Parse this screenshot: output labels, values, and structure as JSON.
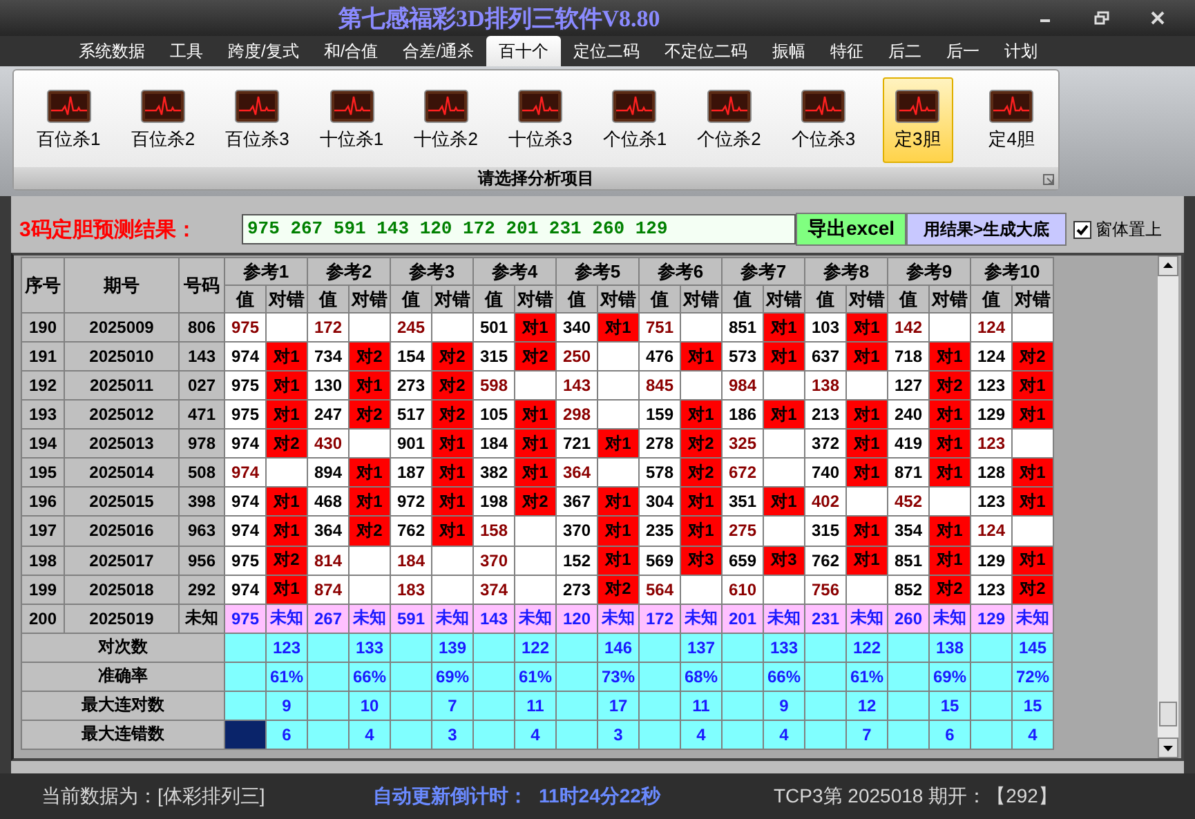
{
  "window": {
    "title": "第七感福彩3D排列三软件V8.80"
  },
  "menu_tabs": [
    {
      "label": "系统数据",
      "selected": false
    },
    {
      "label": "工具",
      "selected": false
    },
    {
      "label": "跨度/复式",
      "selected": false
    },
    {
      "label": "和/合值",
      "selected": false
    },
    {
      "label": "合差/通杀",
      "selected": false
    },
    {
      "label": "百十个",
      "selected": true
    },
    {
      "label": "定位二码",
      "selected": false
    },
    {
      "label": "不定位二码",
      "selected": false
    },
    {
      "label": "振幅",
      "selected": false
    },
    {
      "label": "特征",
      "selected": false
    },
    {
      "label": "后二",
      "selected": false
    },
    {
      "label": "后一",
      "selected": false
    },
    {
      "label": "计划",
      "selected": false
    }
  ],
  "ribbon": {
    "items": [
      {
        "label": "百位杀1",
        "selected": false
      },
      {
        "label": "百位杀2",
        "selected": false
      },
      {
        "label": "百位杀3",
        "selected": false
      },
      {
        "label": "十位杀1",
        "selected": false
      },
      {
        "label": "十位杀2",
        "selected": false
      },
      {
        "label": "十位杀3",
        "selected": false
      },
      {
        "label": "个位杀1",
        "selected": false
      },
      {
        "label": "个位杀2",
        "selected": false
      },
      {
        "label": "个位杀3",
        "selected": false
      },
      {
        "label": "定3胆",
        "selected": true
      },
      {
        "label": "定4胆",
        "selected": false
      }
    ],
    "group_label": "请选择分析项目"
  },
  "result_bar": {
    "label": "3码定胆预测结果：",
    "value": "975 267 591 143 120 172 201 231 260 129",
    "buttons": [
      "导出excel",
      "用结果>生成大底"
    ],
    "stay_on_top": {
      "label": "窗体置上",
      "checked": true
    }
  },
  "table": {
    "columns": [
      "序号",
      "期号",
      "号码"
    ],
    "groups": [
      {
        "label": "参考1",
        "sub_columns": [
          "值",
          "对错"
        ]
      },
      {
        "label": "参考2",
        "sub_columns": [
          "值",
          "对错"
        ]
      },
      {
        "label": "参考3",
        "sub_columns": [
          "值",
          "对错"
        ]
      },
      {
        "label": "参考4",
        "sub_columns": [
          "值",
          "对错"
        ]
      },
      {
        "label": "参考5",
        "sub_columns": [
          "值",
          "对错"
        ]
      },
      {
        "label": "参考6",
        "sub_columns": [
          "值",
          "对错"
        ]
      },
      {
        "label": "参考7",
        "sub_columns": [
          "值",
          "对错"
        ]
      },
      {
        "label": "参考8",
        "sub_columns": [
          "值",
          "对错"
        ]
      },
      {
        "label": "参考9",
        "sub_columns": [
          "值",
          "对错"
        ]
      },
      {
        "label": "参考10",
        "sub_columns": [
          "值",
          "对错"
        ]
      }
    ],
    "rows": [
      {
        "kind": "history",
        "seq": "190",
        "period": "2025009",
        "code": "806",
        "refs": [
          {
            "value": "975"
          },
          {
            "value": "172"
          },
          {
            "value": "245"
          },
          {
            "value": "501",
            "result": "对1"
          },
          {
            "value": "340",
            "result": "对1"
          },
          {
            "value": "751"
          },
          {
            "value": "851",
            "result": "对1"
          },
          {
            "value": "103",
            "result": "对1"
          },
          {
            "value": "142"
          },
          {
            "value": "124"
          }
        ]
      },
      {
        "kind": "history",
        "seq": "191",
        "period": "2025010",
        "code": "143",
        "refs": [
          {
            "value": "974",
            "result": "对1"
          },
          {
            "value": "734",
            "result": "对2"
          },
          {
            "value": "154",
            "result": "对2"
          },
          {
            "value": "315",
            "result": "对2"
          },
          {
            "value": "250"
          },
          {
            "value": "476",
            "result": "对1"
          },
          {
            "value": "573",
            "result": "对1"
          },
          {
            "value": "637",
            "result": "对1"
          },
          {
            "value": "718",
            "result": "对1"
          },
          {
            "value": "124",
            "result": "对2"
          }
        ]
      },
      {
        "kind": "history",
        "seq": "192",
        "period": "2025011",
        "code": "027",
        "refs": [
          {
            "value": "975",
            "result": "对1"
          },
          {
            "value": "130",
            "result": "对1"
          },
          {
            "value": "273",
            "result": "对2"
          },
          {
            "value": "598"
          },
          {
            "value": "143"
          },
          {
            "value": "845"
          },
          {
            "value": "984"
          },
          {
            "value": "138"
          },
          {
            "value": "127",
            "result": "对2"
          },
          {
            "value": "123",
            "result": "对1"
          }
        ]
      },
      {
        "kind": "history",
        "seq": "193",
        "period": "2025012",
        "code": "471",
        "refs": [
          {
            "value": "975",
            "result": "对1"
          },
          {
            "value": "247",
            "result": "对2"
          },
          {
            "value": "517",
            "result": "对2"
          },
          {
            "value": "105",
            "result": "对1"
          },
          {
            "value": "298"
          },
          {
            "value": "159",
            "result": "对1"
          },
          {
            "value": "186",
            "result": "对1"
          },
          {
            "value": "213",
            "result": "对1"
          },
          {
            "value": "240",
            "result": "对1"
          },
          {
            "value": "129",
            "result": "对1"
          }
        ]
      },
      {
        "kind": "history",
        "seq": "194",
        "period": "2025013",
        "code": "978",
        "refs": [
          {
            "value": "974",
            "result": "对2"
          },
          {
            "value": "430"
          },
          {
            "value": "901",
            "result": "对1"
          },
          {
            "value": "184",
            "result": "对1"
          },
          {
            "value": "721",
            "result": "对1"
          },
          {
            "value": "278",
            "result": "对2"
          },
          {
            "value": "325"
          },
          {
            "value": "372",
            "result": "对1"
          },
          {
            "value": "419",
            "result": "对1"
          },
          {
            "value": "123"
          }
        ]
      },
      {
        "kind": "history",
        "seq": "195",
        "period": "2025014",
        "code": "508",
        "refs": [
          {
            "value": "974"
          },
          {
            "value": "894",
            "result": "对1"
          },
          {
            "value": "187",
            "result": "对1"
          },
          {
            "value": "382",
            "result": "对1"
          },
          {
            "value": "364"
          },
          {
            "value": "578",
            "result": "对2"
          },
          {
            "value": "672"
          },
          {
            "value": "740",
            "result": "对1"
          },
          {
            "value": "871",
            "result": "对1"
          },
          {
            "value": "128",
            "result": "对1"
          }
        ]
      },
      {
        "kind": "history",
        "seq": "196",
        "period": "2025015",
        "code": "398",
        "refs": [
          {
            "value": "974",
            "result": "对1"
          },
          {
            "value": "468",
            "result": "对1"
          },
          {
            "value": "972",
            "result": "对1"
          },
          {
            "value": "198",
            "result": "对2"
          },
          {
            "value": "367",
            "result": "对1"
          },
          {
            "value": "304",
            "result": "对1"
          },
          {
            "value": "351",
            "result": "对1"
          },
          {
            "value": "402"
          },
          {
            "value": "452"
          },
          {
            "value": "123",
            "result": "对1"
          }
        ]
      },
      {
        "kind": "history",
        "seq": "197",
        "period": "2025016",
        "code": "963",
        "refs": [
          {
            "value": "974",
            "result": "对1"
          },
          {
            "value": "364",
            "result": "对2"
          },
          {
            "value": "762",
            "result": "对1"
          },
          {
            "value": "158"
          },
          {
            "value": "370",
            "result": "对1"
          },
          {
            "value": "235",
            "result": "对1"
          },
          {
            "value": "275"
          },
          {
            "value": "315",
            "result": "对1"
          },
          {
            "value": "354",
            "result": "对1"
          },
          {
            "value": "124"
          }
        ]
      },
      {
        "kind": "history",
        "seq": "198",
        "period": "2025017",
        "code": "956",
        "refs": [
          {
            "value": "975",
            "result": "对2"
          },
          {
            "value": "814"
          },
          {
            "value": "184"
          },
          {
            "value": "370"
          },
          {
            "value": "152",
            "result": "对1"
          },
          {
            "value": "569",
            "result": "对3"
          },
          {
            "value": "659",
            "result": "对3"
          },
          {
            "value": "762",
            "result": "对1"
          },
          {
            "value": "851",
            "result": "对1"
          },
          {
            "value": "129",
            "result": "对1"
          }
        ]
      },
      {
        "kind": "history",
        "seq": "199",
        "period": "2025018",
        "code": "292",
        "refs": [
          {
            "value": "974",
            "result": "对1"
          },
          {
            "value": "874"
          },
          {
            "value": "183"
          },
          {
            "value": "374"
          },
          {
            "value": "273",
            "result": "对2"
          },
          {
            "value": "564"
          },
          {
            "value": "610"
          },
          {
            "value": "756"
          },
          {
            "value": "852",
            "result": "对2"
          },
          {
            "value": "123",
            "result": "对2"
          }
        ]
      },
      {
        "kind": "pending",
        "seq": "200",
        "period": "2025019",
        "code": "未知",
        "refs": [
          {
            "value": "975",
            "result": "未知"
          },
          {
            "value": "267",
            "result": "未知"
          },
          {
            "value": "591",
            "result": "未知"
          },
          {
            "value": "143",
            "result": "未知"
          },
          {
            "value": "120",
            "result": "未知"
          },
          {
            "value": "172",
            "result": "未知"
          },
          {
            "value": "201",
            "result": "未知"
          },
          {
            "value": "231",
            "result": "未知"
          },
          {
            "value": "260",
            "result": "未知"
          },
          {
            "value": "129",
            "result": "未知"
          }
        ]
      }
    ],
    "summary": [
      {
        "label": "对次数",
        "values": [
          "123",
          "133",
          "139",
          "122",
          "146",
          "137",
          "133",
          "122",
          "138",
          "145"
        ],
        "selected": false
      },
      {
        "label": "准确率",
        "values": [
          "61%",
          "66%",
          "69%",
          "61%",
          "73%",
          "68%",
          "66%",
          "61%",
          "69%",
          "72%"
        ],
        "selected": false
      },
      {
        "label": "最大连对数",
        "values": [
          "9",
          "10",
          "7",
          "11",
          "17",
          "11",
          "9",
          "12",
          "15",
          "15"
        ],
        "selected": false
      },
      {
        "label": "最大连错数",
        "values": [
          "6",
          "4",
          "3",
          "4",
          "3",
          "4",
          "4",
          "7",
          "6",
          "4"
        ],
        "selected": true
      }
    ]
  },
  "status_bar": {
    "data_source": "当前数据为：[体彩排列三]",
    "countdown_label": "自动更新倒计时：",
    "countdown": "11时24分22秒",
    "last_draw": "TCP3第 2025018 期开：【292】"
  }
}
